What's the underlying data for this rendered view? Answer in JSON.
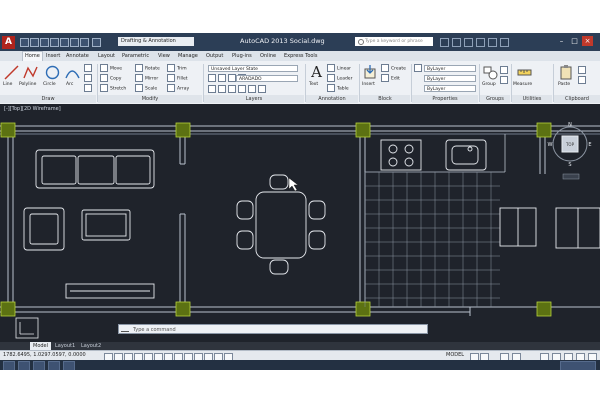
{
  "titlebar": {
    "app_logo": "A",
    "workspace": "Drafting & Annotation",
    "title": "AutoCAD 2013    Social.dwg",
    "search_placeholder": "Type a keyword or phrase"
  },
  "tabs": [
    "Home",
    "Insert",
    "Annotate",
    "Layout",
    "Parametric",
    "View",
    "Manage",
    "Output",
    "Plug-ins",
    "Online",
    "Express Tools"
  ],
  "ribbon": {
    "draw": {
      "label": "Draw",
      "tools": [
        "Line",
        "Polyline",
        "Circle",
        "Arc"
      ]
    },
    "modify": {
      "label": "Modify",
      "tools": [
        "Move",
        "Rotate",
        "Trim",
        "Copy",
        "Mirror",
        "Fillet",
        "Stretch",
        "Scale",
        "Array"
      ]
    },
    "layers": {
      "label": "Layers",
      "state": "Unsaved Layer State",
      "current": "ARADADO"
    },
    "annotation": {
      "label": "Annotation",
      "text": "Text",
      "tools": [
        "Linear",
        "Leader",
        "Table"
      ]
    },
    "block": {
      "label": "Block",
      "insert": "Insert",
      "tools": [
        "Create",
        "Edit"
      ]
    },
    "properties": {
      "label": "Properties",
      "bylayer": "ByLayer"
    },
    "groups": {
      "label": "Groups",
      "group": "Group"
    },
    "utilities": {
      "label": "Utilities",
      "measure": "Measure"
    },
    "clipboard": {
      "label": "Clipboard",
      "paste": "Paste"
    }
  },
  "viewport_label": "[-][Top][2D Wireframe]",
  "compass": {
    "n": "N",
    "s": "S",
    "e": "E",
    "w": "W",
    "top": "TOP"
  },
  "command": {
    "placeholder": "Type a command"
  },
  "layout_tabs": [
    "Model",
    "Layout1",
    "Layout2"
  ],
  "status": {
    "coords": "1782.6495, 1.0297.0597, 0.0000",
    "model": "MODEL"
  },
  "colors": {
    "canvas": "#1f232b",
    "wall": "#b8c1cc",
    "column": "#9ab62a",
    "furniture": "#e6e9ee"
  }
}
